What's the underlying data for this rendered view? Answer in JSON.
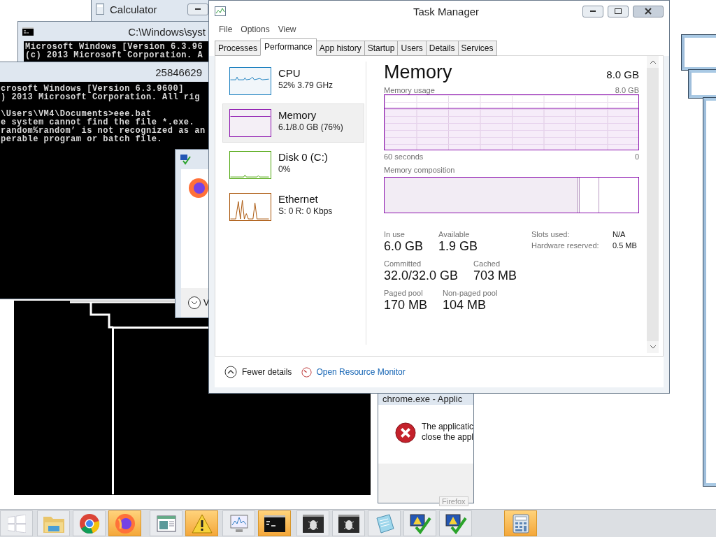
{
  "windows": {
    "calculator": {
      "title": "Calculator"
    },
    "console_back": {
      "title": "C:\\Windows\\syst",
      "blocks": [
        [
          "Microsoft Windows [Version 6.3.96",
          "(c) 2013 Microsoft Corporation. A"
        ]
      ]
    },
    "console_front": {
      "title": "25846629",
      "blocks": [
        [
          "crosoft Windows [Version 6.3.9600]",
          ") 2013 Microsoft Corporation. All rig"
        ],
        [
          "\\Users\\VM4\\Documents>eee.bat",
          "e system cannot find the file *.exe.",
          "random%random’ is not recognized as an",
          "perable program or batch file."
        ]
      ]
    },
    "firefox_dialog": {
      "button_label": "V"
    },
    "error_dialog": {
      "title": "chrome.exe - Applic",
      "message_lines": [
        "The applicatic",
        "close the appl"
      ],
      "taskbar_label": "Firefox"
    }
  },
  "task_manager": {
    "title": "Task Manager",
    "menu": [
      "File",
      "Options",
      "View"
    ],
    "tabs": [
      {
        "label": "Processes",
        "selected": false
      },
      {
        "label": "Performance",
        "selected": true
      },
      {
        "label": "App history",
        "selected": false
      },
      {
        "label": "Startup",
        "selected": false
      },
      {
        "label": "Users",
        "selected": false
      },
      {
        "label": "Details",
        "selected": false
      },
      {
        "label": "Services",
        "selected": false
      }
    ],
    "resources": [
      {
        "kind": "cpu",
        "name": "CPU",
        "detail": "52% 3.79 GHz",
        "selected": false,
        "color": "#1a7fbf"
      },
      {
        "kind": "memory",
        "name": "Memory",
        "detail": "6.1/8.0 GB (76%)",
        "selected": true,
        "color": "#8b12ae"
      },
      {
        "kind": "disk",
        "name": "Disk 0 (C:)",
        "detail": "0%",
        "selected": false,
        "color": "#4da60c"
      },
      {
        "kind": "ethernet",
        "name": "Ethernet",
        "detail": "S: 0 R: 0 Kbps",
        "selected": false,
        "color": "#a74f01"
      }
    ],
    "detail": {
      "title": "Memory",
      "total": "8.0 GB",
      "usage_label": "Memory usage",
      "usage_max": "8.0 GB",
      "time_label": "60 seconds",
      "min_label": "0",
      "composition_label": "Memory composition",
      "composition": {
        "level": 0.76
      },
      "stats": [
        {
          "label": "In use",
          "value": "6.0 GB"
        },
        {
          "label": "Available",
          "value": "1.9 GB"
        },
        {
          "label": "Committed",
          "value": "32.0/32.0 GB"
        },
        {
          "label": "Cached",
          "value": "703 MB"
        },
        {
          "label": "Paged pool",
          "value": "170 MB"
        },
        {
          "label": "Non-paged pool",
          "value": "104 MB"
        }
      ],
      "hardware": [
        {
          "label": "Slots used:",
          "value": "N/A"
        },
        {
          "label": "Hardware reserved:",
          "value": "0.5 MB"
        }
      ]
    },
    "footer": {
      "fewer_details": "Fewer details",
      "resource_monitor": "Open Resource Monitor"
    }
  },
  "taskbar": {
    "items": [
      {
        "kind": "start",
        "highlighted": false
      },
      {
        "kind": "folder",
        "highlighted": false
      },
      {
        "kind": "chrome",
        "highlighted": false
      },
      {
        "kind": "firefox",
        "highlighted": true
      },
      {
        "kind": "window",
        "highlighted": false
      },
      {
        "kind": "warning",
        "highlighted": true
      },
      {
        "kind": "monitor",
        "highlighted": false
      },
      {
        "kind": "terminal",
        "highlighted": true
      },
      {
        "kind": "bug",
        "highlighted": false
      },
      {
        "kind": "bug",
        "highlighted": false
      },
      {
        "kind": "notepad",
        "highlighted": false
      },
      {
        "kind": "check",
        "highlighted": false
      },
      {
        "kind": "check",
        "highlighted": false
      },
      {
        "kind": "calculator",
        "highlighted": true
      }
    ]
  }
}
